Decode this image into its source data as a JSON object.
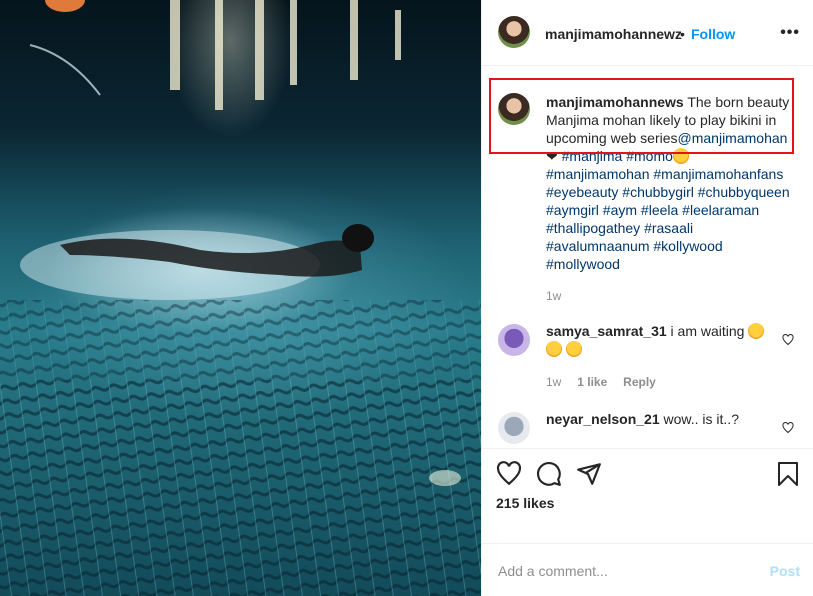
{
  "header": {
    "username": "manjimamohannewz",
    "separator": "•",
    "follow_label": "Follow",
    "more_icon": "•••"
  },
  "caption": {
    "username": "manjimamohannews",
    "text": "The born beauty Manjima mohan likely to play bikini in upcoming web series",
    "mention": "@manjimamohan",
    "hashtags_line1": "#manjima #momo",
    "hashtags": "#manjimamohan #manjimamohanfans #eyebeauty #chubbygirl #chubbyqueen #aymgirl #aym #leela #leelaraman #thallipogathey #rasaali #avalumnaanum #kollywood #mollywood",
    "time": "1w"
  },
  "comments": [
    {
      "username": "samya_samrat_31",
      "text": "i am waiting",
      "time": "1w",
      "likes": "1 like",
      "reply_label": "Reply"
    },
    {
      "username": "neyar_nelson_21",
      "text": "wow.. is it..?"
    }
  ],
  "actions": {
    "likes": "215 likes"
  },
  "add_comment": {
    "placeholder": "Add a comment...",
    "post_label": "Post"
  },
  "colors": {
    "link": "#0095f6",
    "hashtag": "#00376b",
    "highlight": "#e1141b"
  }
}
